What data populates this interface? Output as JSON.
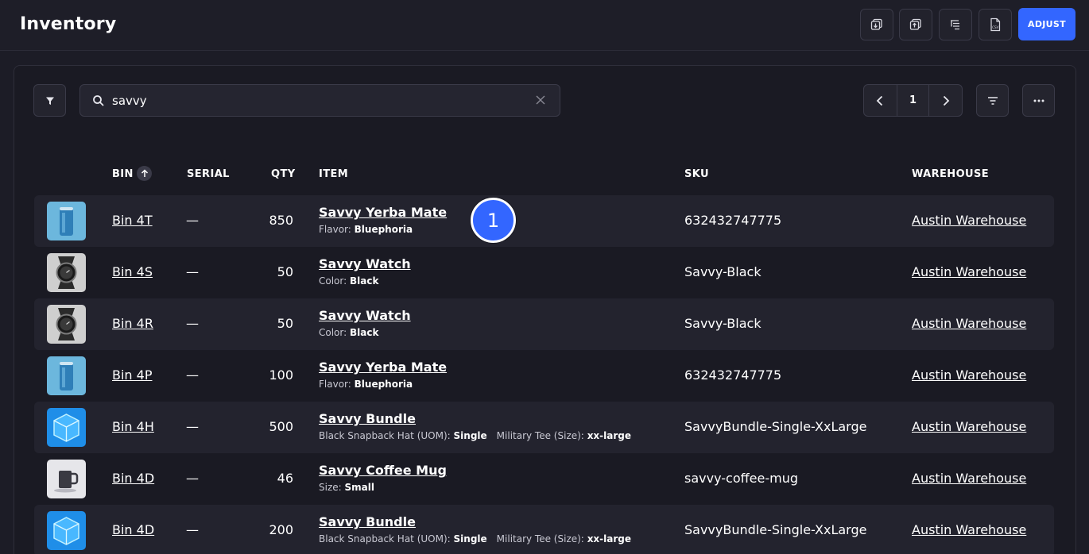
{
  "header": {
    "title": "Inventory",
    "adjust_label": "ADJUST",
    "buttons": [
      "import-icon",
      "export-icon",
      "tree-icon",
      "csv-icon"
    ],
    "csv_label": "CSV"
  },
  "toolbar": {
    "search_value": "savvy",
    "page": "1"
  },
  "table": {
    "columns": {
      "bin": "BIN",
      "serial": "SERIAL",
      "qty": "QTY",
      "item": "ITEM",
      "sku": "SKU",
      "warehouse": "WAREHOUSE"
    },
    "rows": [
      {
        "thumb": "can",
        "bin": "Bin 4T",
        "serial": "—",
        "qty": "850",
        "item": "Savvy Yerba Mate",
        "attrs": [
          {
            "k": "Flavor:",
            "v": "Bluephoria"
          }
        ],
        "sku": "632432747775",
        "warehouse": "Austin Warehouse"
      },
      {
        "thumb": "watch",
        "bin": "Bin 4S",
        "serial": "—",
        "qty": "50",
        "item": "Savvy Watch",
        "attrs": [
          {
            "k": "Color:",
            "v": "Black"
          }
        ],
        "sku": "Savvy-Black",
        "warehouse": "Austin Warehouse"
      },
      {
        "thumb": "watch",
        "bin": "Bin 4R",
        "serial": "—",
        "qty": "50",
        "item": "Savvy Watch",
        "attrs": [
          {
            "k": "Color:",
            "v": "Black"
          }
        ],
        "sku": "Savvy-Black",
        "warehouse": "Austin Warehouse"
      },
      {
        "thumb": "can",
        "bin": "Bin 4P",
        "serial": "—",
        "qty": "100",
        "item": "Savvy Yerba Mate",
        "attrs": [
          {
            "k": "Flavor:",
            "v": "Bluephoria"
          }
        ],
        "sku": "632432747775",
        "warehouse": "Austin Warehouse"
      },
      {
        "thumb": "cube",
        "bin": "Bin 4H",
        "serial": "—",
        "qty": "500",
        "item": "Savvy Bundle",
        "attrs": [
          {
            "k": "Black Snapback Hat (UOM):",
            "v": "Single"
          },
          {
            "k": "Military Tee (Size):",
            "v": "xx-large"
          }
        ],
        "sku": "SavvyBundle-Single-XxLarge",
        "warehouse": "Austin Warehouse"
      },
      {
        "thumb": "mug",
        "bin": "Bin 4D",
        "serial": "—",
        "qty": "46",
        "item": "Savvy Coffee Mug",
        "attrs": [
          {
            "k": "Size:",
            "v": "Small"
          }
        ],
        "sku": "savvy-coffee-mug",
        "warehouse": "Austin Warehouse"
      },
      {
        "thumb": "cube",
        "bin": "Bin 4D",
        "serial": "—",
        "qty": "200",
        "item": "Savvy Bundle",
        "attrs": [
          {
            "k": "Black Snapback Hat (UOM):",
            "v": "Single"
          },
          {
            "k": "Military Tee (Size):",
            "v": "xx-large"
          }
        ],
        "sku": "SavvyBundle-Single-XxLarge",
        "warehouse": "Austin Warehouse"
      }
    ]
  },
  "step_badge": "1",
  "colors": {
    "accent": "#3366ff",
    "background": "#1c1c26",
    "row_alt": "#23232e"
  }
}
